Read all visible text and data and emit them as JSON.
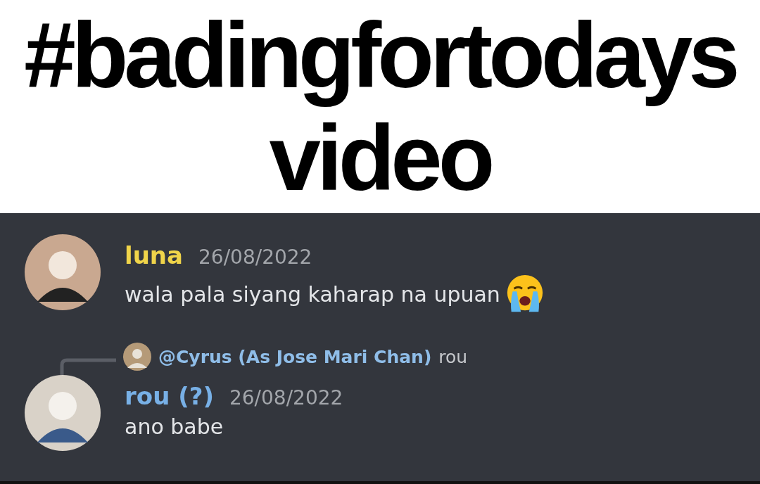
{
  "caption": {
    "lines": [
      "#badingfortodays",
      "video"
    ]
  },
  "messages": [
    {
      "author": "luna",
      "color": "#f0d44a",
      "timestamp": "26/08/2022",
      "text": "wala pala siyang kaharap na upuan",
      "crying_emoji": true
    },
    {
      "author": "rou (?)",
      "color": "#78b0e6",
      "timestamp": "26/08/2022",
      "text": "ano babe",
      "reply": {
        "mention": "@Cyrus (As Jose Mari Chan)",
        "text": "rou"
      }
    }
  ]
}
